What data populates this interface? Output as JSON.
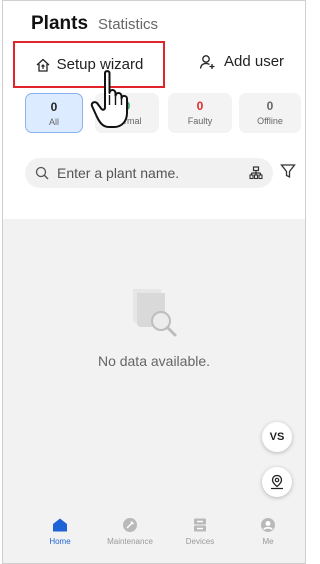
{
  "header": {
    "tab_active": "Plants",
    "tab_other": "Statistics"
  },
  "actions": {
    "setup_wizard": "Setup wizard",
    "add_user": "Add user"
  },
  "status_cards": [
    {
      "count": "0",
      "label": "All"
    },
    {
      "count": "0",
      "label": "Normal"
    },
    {
      "count": "0",
      "label": "Faulty"
    },
    {
      "count": "0",
      "label": "Offline"
    }
  ],
  "search": {
    "placeholder": "Enter a plant name."
  },
  "empty_state": {
    "text": "No data available."
  },
  "fabs": {
    "vs": "VS"
  },
  "bottom_nav": [
    {
      "label": "Home",
      "icon": "home-icon"
    },
    {
      "label": "Maintenance",
      "icon": "maintenance-icon"
    },
    {
      "label": "Devices",
      "icon": "devices-icon"
    },
    {
      "label": "Me",
      "icon": "me-icon"
    }
  ],
  "colors": {
    "accent": "#1e64d6",
    "highlight_border": "#e0262b",
    "normal": "#3ba36b",
    "faulty": "#e32b2b"
  }
}
